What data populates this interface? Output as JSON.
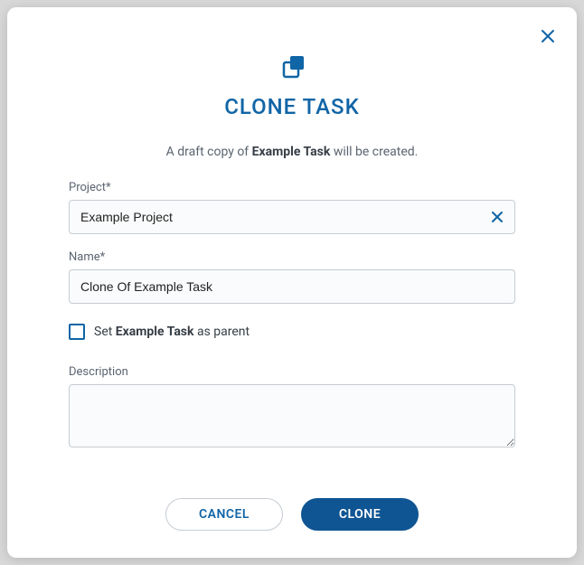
{
  "dialog": {
    "title": "CLONE TASK",
    "subtitle_prefix": "A draft copy of ",
    "subtitle_task": "Example Task",
    "subtitle_suffix": " will be created."
  },
  "fields": {
    "project": {
      "label": "Project*",
      "value": "Example Project"
    },
    "name": {
      "label": "Name*",
      "value": "Clone Of Example Task"
    },
    "setParent": {
      "prefix": "Set ",
      "task": "Example Task",
      "suffix": " as parent",
      "checked": false
    },
    "description": {
      "label": "Description",
      "value": ""
    }
  },
  "buttons": {
    "cancel": "CANCEL",
    "clone": "CLONE"
  },
  "colors": {
    "primary": "#1065a6",
    "primary_dark": "#0f5593"
  }
}
